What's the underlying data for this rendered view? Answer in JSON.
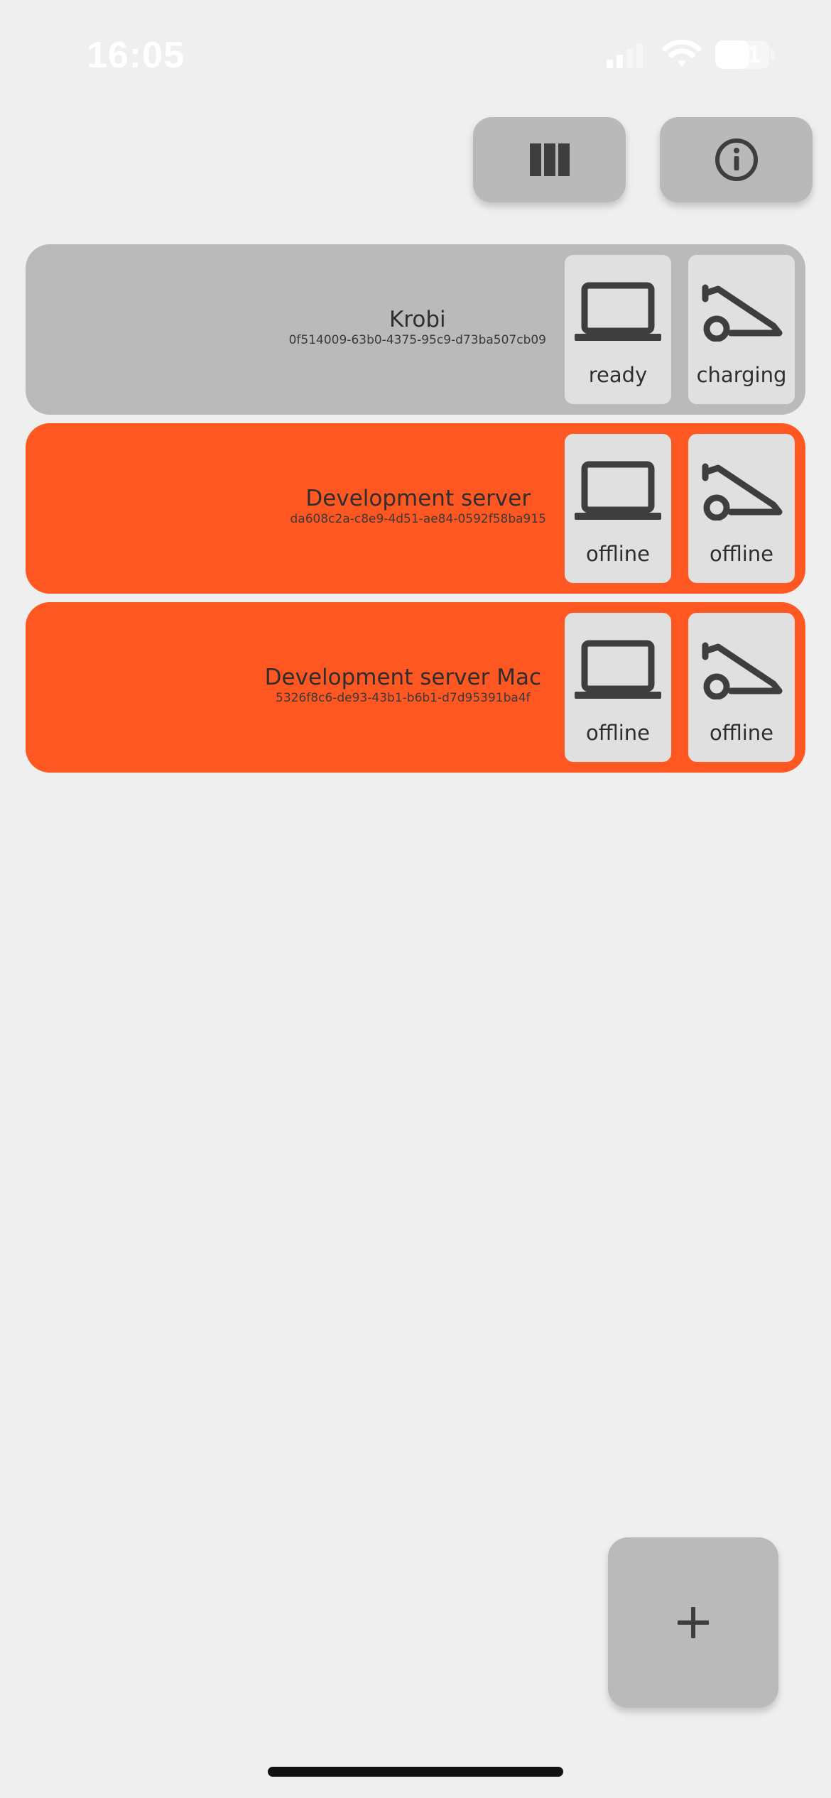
{
  "status_bar": {
    "time": "16:05",
    "battery": "61"
  },
  "toolbar": {
    "columns_icon": "columns-icon",
    "info_icon": "info-icon"
  },
  "devices": [
    {
      "name": "Krobi",
      "id": "0f514009-63b0-4375-95c9-d73ba507cb09",
      "computer_status": "ready",
      "mower_status": "charging",
      "row_color": "#bababa"
    },
    {
      "name": "Development server",
      "id": "da608c2a-c8e9-4d51-ae84-0592f58ba915",
      "computer_status": "offline",
      "mower_status": "offline",
      "row_color": "#ff5722"
    },
    {
      "name": "Development server Mac",
      "id": "5326f8c6-de93-43b1-b6b1-d7d95391ba4f",
      "computer_status": "offline",
      "mower_status": "offline",
      "row_color": "#ff5722"
    }
  ],
  "add_button": {
    "icon": "plus-icon"
  },
  "colors": {
    "background": "#efefef",
    "offline": "#ff5722",
    "online": "#bababa",
    "tile": "#e0e0e0",
    "icon": "#3e3e3e"
  }
}
